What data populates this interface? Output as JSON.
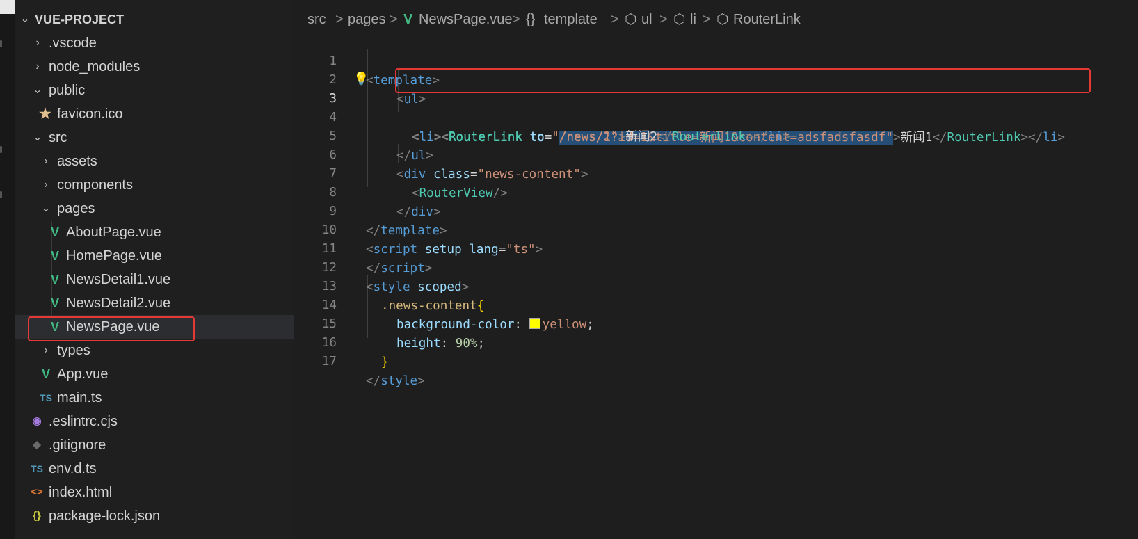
{
  "explorer": {
    "root_label": "VUE-PROJECT",
    "items": [
      {
        "label": ".vscode"
      },
      {
        "label": "node_modules"
      },
      {
        "label": "public"
      },
      {
        "label": "favicon.ico"
      },
      {
        "label": "src"
      },
      {
        "label": "assets"
      },
      {
        "label": "components"
      },
      {
        "label": "pages"
      },
      {
        "label": "AboutPage.vue"
      },
      {
        "label": "HomePage.vue"
      },
      {
        "label": "NewsDetail1.vue"
      },
      {
        "label": "NewsDetail2.vue"
      },
      {
        "label": "NewsPage.vue"
      },
      {
        "label": "types"
      },
      {
        "label": "App.vue"
      },
      {
        "label": "main.ts"
      },
      {
        "label": ".eslintrc.cjs"
      },
      {
        "label": ".gitignore"
      },
      {
        "label": "env.d.ts"
      },
      {
        "label": "index.html"
      },
      {
        "label": "package-lock.json"
      }
    ],
    "icon_glyphs": {
      "vue": "V",
      "ts": "TS",
      "star": "★",
      "eslint": "◉",
      "git": "◆",
      "html": "<>",
      "json": "{}"
    }
  },
  "breadcrumb": {
    "items": [
      "src",
      "pages",
      "NewsPage.vue",
      "template",
      "ul",
      "li",
      "RouterLink"
    ],
    "separator": ">",
    "glyphs": {
      "braces": "{}",
      "cube": "⬡",
      "vue": "V"
    }
  },
  "editor": {
    "active_line": 3,
    "line_numbers": [
      "1",
      "2",
      "3",
      "4",
      "5",
      "6",
      "7",
      "8",
      "9",
      "10",
      "11",
      "12",
      "13",
      "14",
      "15",
      "16",
      "17"
    ],
    "lines": [
      [
        "<",
        "template",
        ">"
      ],
      [
        "<",
        "ul",
        ">"
      ],
      [
        "<",
        "li",
        "><",
        "RouterLink",
        " ",
        "to",
        "=",
        "\"",
        "/news/1?id=1&title=新闻1&content=adsfadsfasdf\"",
        ">",
        "新闻1",
        "</",
        "RouterLink",
        "></",
        "li",
        ">"
      ],
      [
        "<",
        "li",
        "><",
        "RouterLink",
        " ",
        "to",
        "=",
        "\"/news/2\"",
        ">",
        "新闻2",
        "</",
        "RouterLink",
        "></",
        "li",
        ">"
      ],
      [
        "</",
        "ul",
        ">"
      ],
      [
        "<",
        "div",
        " ",
        "class",
        "=",
        "\"news-content\"",
        ">"
      ],
      [
        "<",
        "RouterView",
        "/>"
      ],
      [
        "</",
        "div",
        ">"
      ],
      [
        "</",
        "template",
        ">"
      ],
      [
        "<",
        "script",
        " ",
        "setup",
        " ",
        "lang",
        "=",
        "\"ts\"",
        ">"
      ],
      [
        "</",
        "script",
        ">"
      ],
      [
        "<",
        "style",
        " ",
        "scoped",
        ">"
      ],
      [
        ".news-content",
        "{"
      ],
      [
        "background-color",
        ": ",
        "yellow",
        ";"
      ],
      [
        "height",
        ": ",
        "90%",
        ";"
      ],
      [
        "}"
      ],
      [
        "</",
        "style",
        ">"
      ]
    ],
    "swatch_color": "#ffff00"
  },
  "colors": {
    "highlight_box": "#e53935",
    "selection": "#264f78",
    "vue_green": "#42b883"
  }
}
